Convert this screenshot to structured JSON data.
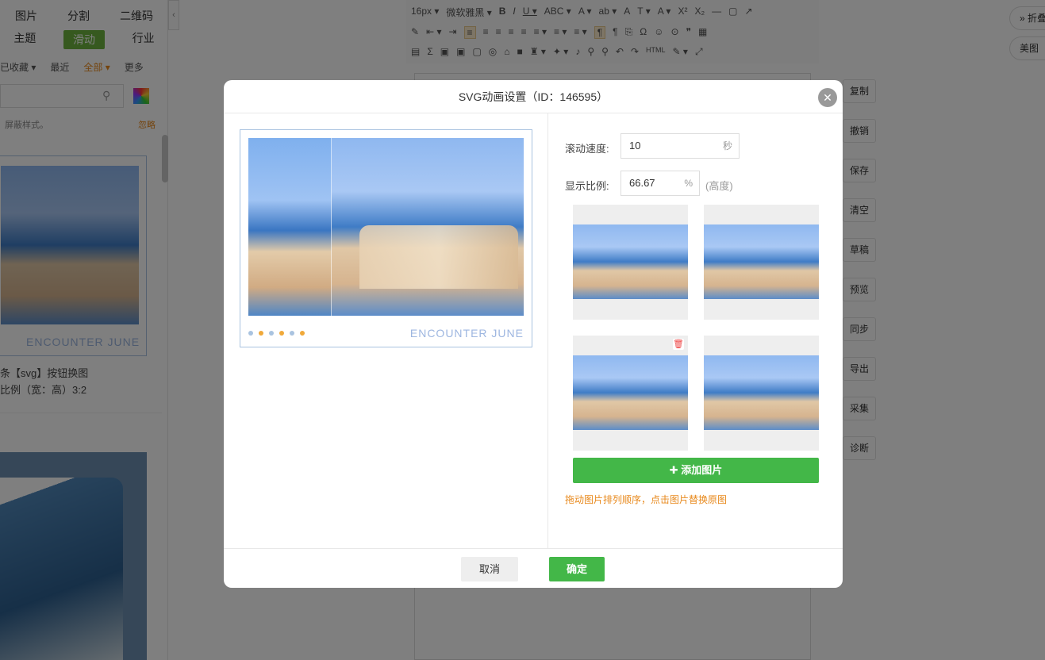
{
  "left_panel": {
    "nav_row1": [
      "图片",
      "分割",
      "二维码"
    ],
    "nav_row2": [
      "主题",
      "滑动",
      "行业"
    ],
    "filters": [
      "已收藏 ▾",
      "最近",
      "全部 ▾",
      "更多"
    ],
    "hint_left": "屏蔽样式。",
    "hint_right": "忽略",
    "card1_text": "ENCOUNTER JUNE",
    "card1_caption1": "条【svg】按钮换图",
    "card1_caption2": "比例（宽：高）3:2"
  },
  "toolbar": {
    "row1": [
      "16px ▾",
      "微软雅黑 ▾",
      "B",
      "I",
      "U ▾",
      "ABC ▾",
      "A ▾",
      "ab ▾",
      "A",
      "T ▾",
      "A ▾",
      "X²",
      "X₂",
      "—",
      "▢",
      "↗"
    ],
    "row2": [
      "✎",
      "⇤ ▾",
      "⇥",
      "≡",
      "≡",
      "≡",
      "≡",
      "≡",
      "≡ ▾",
      "≡ ▾",
      "≡ ▾",
      "¶",
      "¶",
      "⎘",
      "Ω",
      "☺",
      "⊙",
      "❞",
      "▦"
    ],
    "row3": [
      "▤",
      "Σ",
      "▣",
      "▣",
      "▢",
      "◎",
      "⌂",
      "■",
      "♜ ▾",
      "✦ ▾",
      "♪",
      "⚲",
      "⚲",
      "↶",
      "↷",
      "HTML",
      "✎ ▾",
      "⤢"
    ]
  },
  "side_buttons": [
    "复制",
    "撤销",
    "保存",
    "清空",
    "草稿",
    "预览",
    "同步",
    "导出",
    "采集",
    "诊断"
  ],
  "pills": [
    "» 折叠",
    "美图"
  ],
  "dialog": {
    "title": "SVG动画设置（ID：146595）",
    "close": "✕",
    "preview_text": "ENCOUNTER JUNE",
    "dot_colors": [
      "#a9c3e0",
      "#f0a93a",
      "#a9c3e0",
      "#f0a93a",
      "#a9c3e0",
      "#f0a93a"
    ],
    "speed_label": "滚动速度:",
    "speed_value": "10",
    "speed_unit": "秒",
    "ratio_label": "显示比例:",
    "ratio_value": "66.67",
    "ratio_unit": "%",
    "ratio_note": "(高度)",
    "add_button": "✚  添加图片",
    "tip": "拖动图片排列顺序，点击图片替换原图",
    "cancel": "取消",
    "ok": "确定"
  },
  "colors": {
    "accent_green": "#43b748",
    "tip_orange": "#e8891c",
    "border_blue": "#a9c3e0"
  }
}
